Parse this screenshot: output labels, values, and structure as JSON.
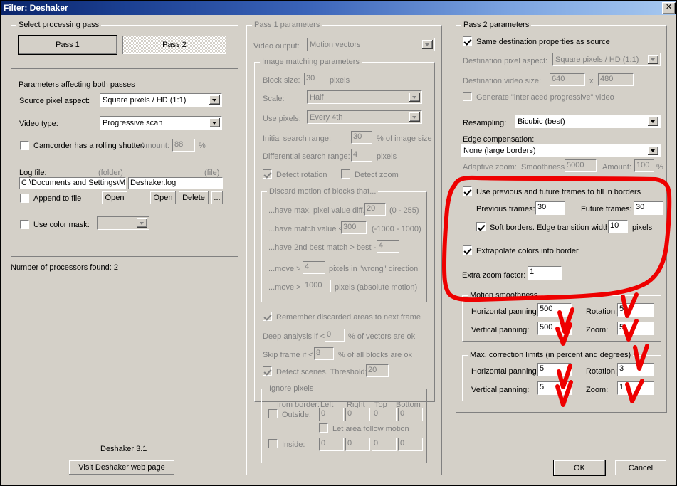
{
  "window": {
    "title": "Filter: Deshaker",
    "close_label": "✕"
  },
  "left": {
    "select_pass": {
      "legend": "Select processing pass",
      "pass1": "Pass 1",
      "pass2": "Pass 2"
    },
    "both": {
      "legend": "Parameters affecting both passes",
      "source_pixel_aspect_label": "Source pixel aspect:",
      "source_pixel_aspect_value": "Square pixels / HD  (1:1)",
      "video_type_label": "Video type:",
      "video_type_value": "Progressive scan",
      "rolling_shutter_label": "Camcorder has a rolling shutter.",
      "rolling_shutter_checked": false,
      "amount_label": "Amount:",
      "amount_value": "88",
      "percent": "%",
      "log_file_label": "Log file:",
      "folder_hint": "(folder)",
      "file_hint": "(file)",
      "log_folder_value": "C:\\Documents and Settings\\M",
      "log_file_value": "Deshaker.log",
      "append_label": "Append to file",
      "append_checked": false,
      "open_folder_label": "Open",
      "open_file_label": "Open",
      "delete_label": "Delete",
      "browse_label": "...",
      "color_mask_label": "Use color mask:",
      "color_mask_checked": false
    },
    "processors_text": "Number of processors found:  2",
    "version_text": "Deshaker 3.1",
    "web_button": "Visit Deshaker web page"
  },
  "pass1": {
    "legend": "Pass 1 parameters",
    "video_output_label": "Video output:",
    "video_output_value": "Motion vectors",
    "image_matching": {
      "legend": "Image matching parameters",
      "block_size_label": "Block size:",
      "block_size_value": "30",
      "block_size_unit": "pixels",
      "scale_label": "Scale:",
      "scale_value": "Half",
      "use_pixels_label": "Use pixels:",
      "use_pixels_value": "Every 4th",
      "initial_search_label": "Initial search range:",
      "initial_search_value": "30",
      "initial_search_unit": "% of image size",
      "diff_search_label": "Differential search range:",
      "diff_search_value": "4",
      "diff_search_unit": "pixels",
      "detect_rotation_label": "Detect rotation",
      "detect_rotation_checked": true,
      "detect_zoom_label": "Detect zoom",
      "detect_zoom_checked": false,
      "discard": {
        "legend": "Discard motion of blocks that...",
        "max_pixel_diff_label": "...have max. pixel value diff. <",
        "max_pixel_diff_value": "20",
        "max_pixel_diff_range": "(0 - 255)",
        "match_value_label": "...have match value <",
        "match_value_value": "300",
        "match_value_range": "(-1000 - 1000)",
        "second_best_label": "...have 2nd best match > best -",
        "second_best_value": "4",
        "move_wrong_label": "...move >",
        "move_wrong_value": "4",
        "move_wrong_unit": "pixels in \"wrong\" direction",
        "move_abs_label": "...move >",
        "move_abs_value": "1000",
        "move_abs_unit": "pixels (absolute motion)"
      },
      "remember_label": "Remember discarded areas to next frame",
      "remember_checked": true,
      "deep_analysis_label": "Deep analysis if <",
      "deep_analysis_value": "0",
      "deep_analysis_unit": "% of vectors are ok",
      "skip_frame_label": "Skip frame if <",
      "skip_frame_value": "8",
      "skip_frame_unit": "% of all blocks are ok",
      "detect_scenes_label": "Detect scenes. Threshold:",
      "detect_scenes_checked": true,
      "detect_scenes_value": "20",
      "ignore": {
        "legend": "Ignore pixels",
        "from_border_label": "from border:",
        "col_left": "Left",
        "col_right": "Right",
        "col_top": "Top",
        "col_bottom": "Bottom",
        "outside_label": "Outside:",
        "outside_checked": false,
        "outside_values": [
          "0",
          "0",
          "0",
          "0"
        ],
        "follow_label": "Let area follow motion",
        "follow_checked": false,
        "inside_label": "Inside:",
        "inside_checked": false,
        "inside_values": [
          "0",
          "0",
          "0",
          "0"
        ]
      }
    }
  },
  "pass2": {
    "legend": "Pass 2 parameters",
    "same_dest_label": "Same destination properties as source",
    "same_dest_checked": true,
    "dest_aspect_label": "Destination pixel aspect:",
    "dest_aspect_value": "Square pixels / HD  (1:1)",
    "dest_size_label": "Destination video size:",
    "dest_width": "640",
    "dest_x": "x",
    "dest_height": "480",
    "interlaced_label": "Generate \"interlaced progressive\" video",
    "interlaced_checked": false,
    "resampling_label": "Resampling:",
    "resampling_value": "Bicubic  (best)",
    "edge_comp_label": "Edge compensation:",
    "edge_comp_value": "None  (large borders)",
    "adaptive_zoom_label": "Adaptive zoom:",
    "smoothness_label": "Smoothness:",
    "smoothness_value": "5000",
    "amount_label": "Amount:",
    "amount_value": "100",
    "percent": "%",
    "use_prev_future_label": "Use previous and future frames to fill in borders",
    "use_prev_future_checked": true,
    "previous_frames_label": "Previous frames:",
    "previous_frames_value": "30",
    "future_frames_label": "Future frames:",
    "future_frames_value": "30",
    "soft_borders_label": "Soft borders. Edge transition width:",
    "soft_borders_checked": true,
    "soft_borders_value": "10",
    "soft_borders_unit": "pixels",
    "extrapolate_label": "Extrapolate colors into border",
    "extrapolate_checked": true,
    "extra_zoom_label": "Extra zoom factor:",
    "extra_zoom_value": "1",
    "motion_smoothness": {
      "legend": "Motion smoothness",
      "horizontal_label": "Horizontal panning:",
      "horizontal_value": "500",
      "rotation_label": "Rotation:",
      "rotation_value": "50",
      "vertical_label": "Vertical panning:",
      "vertical_value": "500",
      "zoom_label": "Zoom:",
      "zoom_value": "5"
    },
    "max_limits": {
      "legend": "Max. correction limits (in percent and degrees)",
      "horizontal_label": "Horizontal panning:",
      "horizontal_value": "5",
      "rotation_label": "Rotation:",
      "rotation_value": "3",
      "vertical_label": "Vertical panning:",
      "vertical_value": "5",
      "zoom_label": "Zoom:",
      "zoom_value": "1"
    }
  },
  "footer": {
    "ok": "OK",
    "cancel": "Cancel"
  },
  "annotations": {
    "color": "#ee0000",
    "shapes": [
      "ellipse-around-border-fill-options",
      "checkmark-rotation",
      "checkmark-horizontal-panning",
      "checkmark-vertical-panning",
      "checkmark-zoom",
      "checkmark-max-rotation",
      "checkmark-max-horizontal",
      "checkmark-max-vertical",
      "checkmark-max-zoom"
    ]
  }
}
